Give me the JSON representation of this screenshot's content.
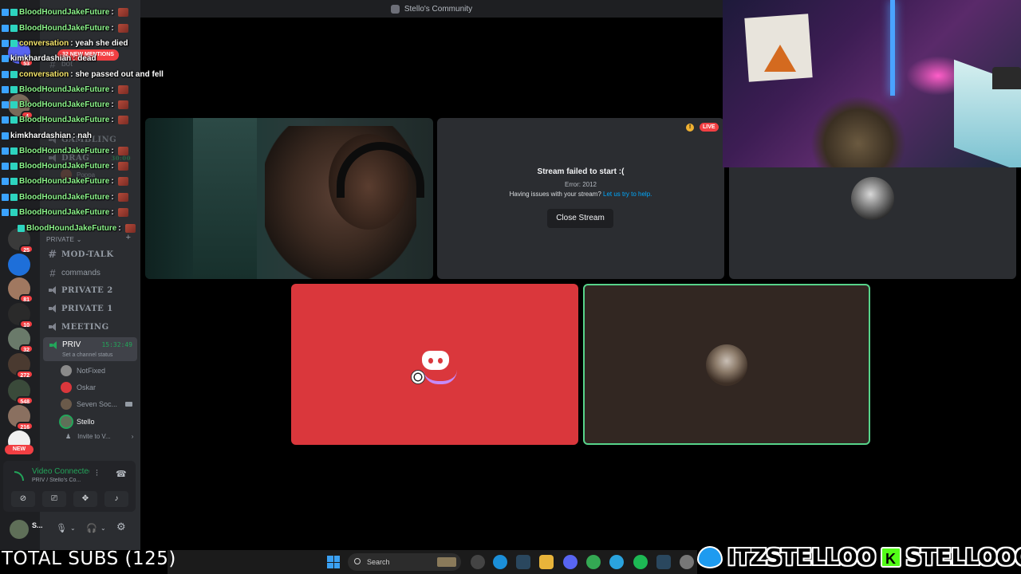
{
  "window": {
    "title": "Stello's Community"
  },
  "chat_overlay": {
    "mentions_badge": "32 NEW MENTIONS",
    "messages": [
      {
        "user": "BloodHoundJakeFuture",
        "text": " :"
      },
      {
        "user": "BloodHoundJakeFuture",
        "text": " :"
      },
      {
        "user": "conversation",
        "text": " : yeah she died"
      },
      {
        "user": "kimkhardashian",
        "text": " : dead"
      },
      {
        "user": "conversation",
        "text": " : she passed out and fell"
      },
      {
        "user": "BloodHoundJakeFuture",
        "text": " :"
      },
      {
        "user": "BloodHoundJakeFuture",
        "text": " :"
      },
      {
        "user": "BloodHoundJakeFuture",
        "text": " :"
      },
      {
        "user": "kimkhardashian",
        "text": " : nah"
      },
      {
        "user": "BloodHoundJakeFuture",
        "text": " :"
      },
      {
        "user": "BloodHoundJakeFuture",
        "text": " :"
      },
      {
        "user": "BloodHoundJakeFuture",
        "text": " :"
      },
      {
        "user": "BloodHoundJakeFuture",
        "text": " :"
      },
      {
        "user": "BloodHoundJakeFuture",
        "text": " :"
      },
      {
        "user": "BloodHoundJakeFuture",
        "text": " :"
      }
    ]
  },
  "server_rail": {
    "badges": [
      "53",
      "4",
      "25",
      "81",
      "10",
      "32",
      "272",
      "548",
      "216"
    ],
    "new_label": "NEW"
  },
  "sidebar": {
    "partial_items": {
      "bot": "bot",
      "gambling": "GAMBLING",
      "drag": "DRAG",
      "drag_time": "30:00",
      "poppa": "Poppa"
    },
    "category_private": "PRIVATE",
    "channels": [
      {
        "label": "MOD-TALK",
        "kind": "text"
      },
      {
        "label": "commands",
        "kind": "text"
      },
      {
        "label": "PRIVATE 2",
        "kind": "voice"
      },
      {
        "label": "PRIVATE 1",
        "kind": "voice"
      },
      {
        "label": "MEETING",
        "kind": "voice"
      }
    ],
    "active_channel": {
      "label": "PRIV",
      "timer": "15:32:49",
      "status": "Set a channel status"
    },
    "voice_users": [
      {
        "name": "NotFixed"
      },
      {
        "name": "Oskar"
      },
      {
        "name": "Seven Soc..."
      },
      {
        "name": "Stello"
      }
    ],
    "invite_label": "Invite to V..."
  },
  "voice_panel": {
    "status": "Video Connected",
    "location": "PRIV / Stello's Co..."
  },
  "user_panel": {
    "name": "S..."
  },
  "tiles": {
    "failed_stream": {
      "live_label": "LIVE",
      "warning_icon": "!",
      "title": "Stream failed to start :(",
      "error": "Error: 2012",
      "help_prefix": "Having issues with your stream?",
      "help_link": "Let us try to help.",
      "close_button": "Close Stream"
    }
  },
  "overlay": {
    "total_subs": "TOTAL SUBS (125)",
    "twitter_handle": "ITZSTELLOO",
    "kick_letter": "K",
    "kick_handle": "STELLOOO"
  },
  "taskbar": {
    "search_label": "Search"
  },
  "colors": {
    "accent_green": "#23a55a",
    "danger_red": "#da373c",
    "link_blue": "#00a8fc"
  },
  "icons": [
    "search-icon",
    "windows-start-icon",
    "mic-icon",
    "headphones-icon",
    "gear-icon",
    "camera-off-icon",
    "screen-share-icon",
    "activities-icon",
    "soundboard-icon",
    "disconnect-icon",
    "warning-icon"
  ]
}
